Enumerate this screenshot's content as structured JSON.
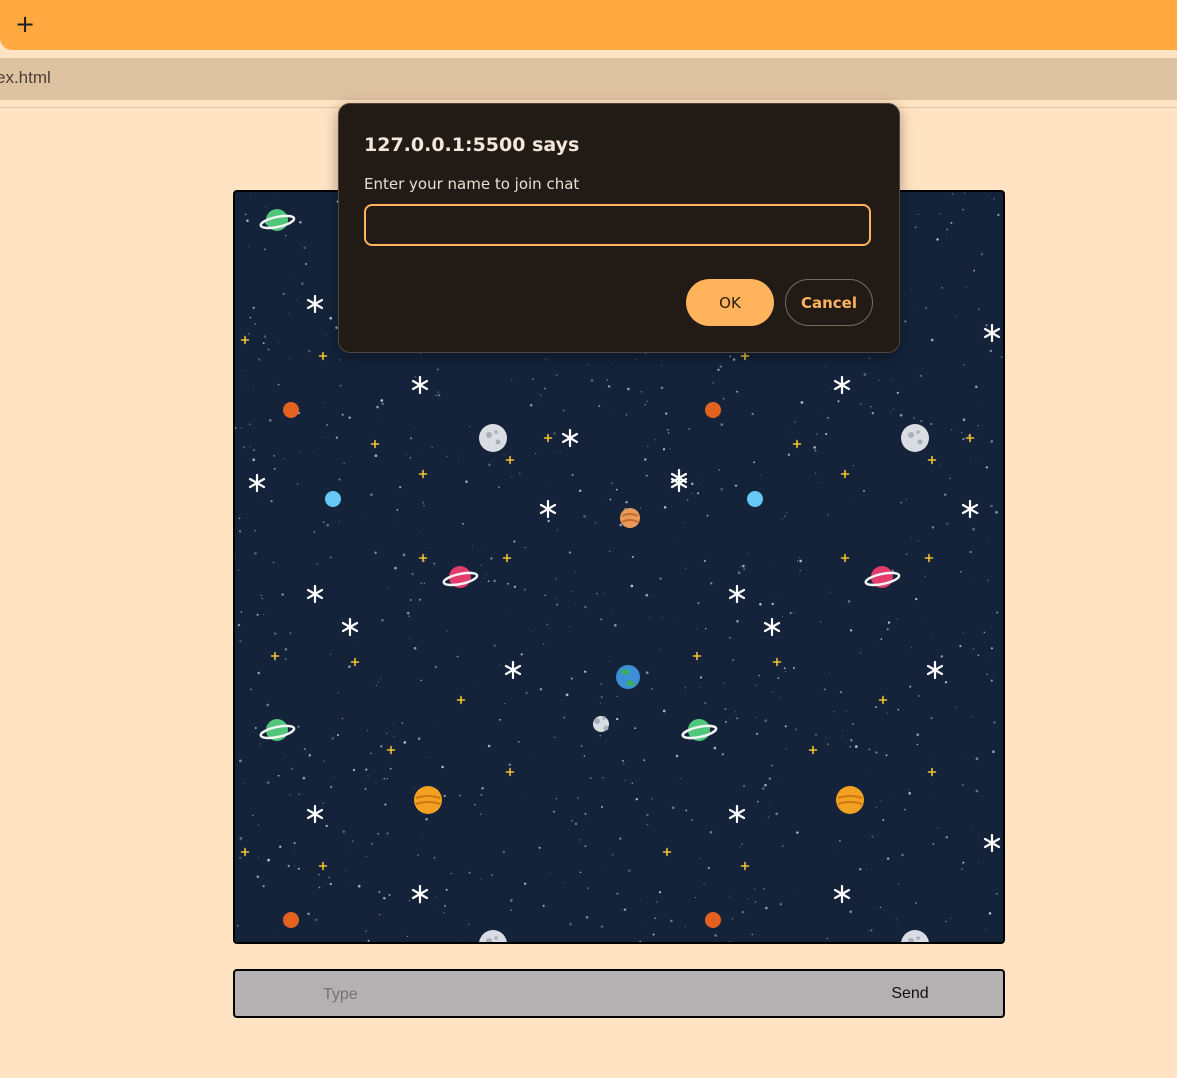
{
  "browser": {
    "new_tab_label": "+",
    "url_fragment": "ex.html"
  },
  "chat": {
    "message_placeholder": "Type",
    "send_label": "Send",
    "wallpaper": {
      "background": "#14233a",
      "icons": [
        "ringed-planet-icon",
        "moon-icon",
        "earth-icon",
        "star-icon",
        "sparkle-icon"
      ]
    }
  },
  "dialog": {
    "title": "127.0.0.1:5500 says",
    "message": "Enter your name to join chat",
    "input_value": "",
    "ok_label": "OK",
    "cancel_label": "Cancel"
  },
  "colors": {
    "tab_strip": "#ffa940",
    "address_bar": "#dec3a2",
    "page_bg": "#ffe3c2",
    "dialog_bg": "#221a15",
    "accent": "#ffb35c",
    "input_bar": "#b3b1b1"
  }
}
